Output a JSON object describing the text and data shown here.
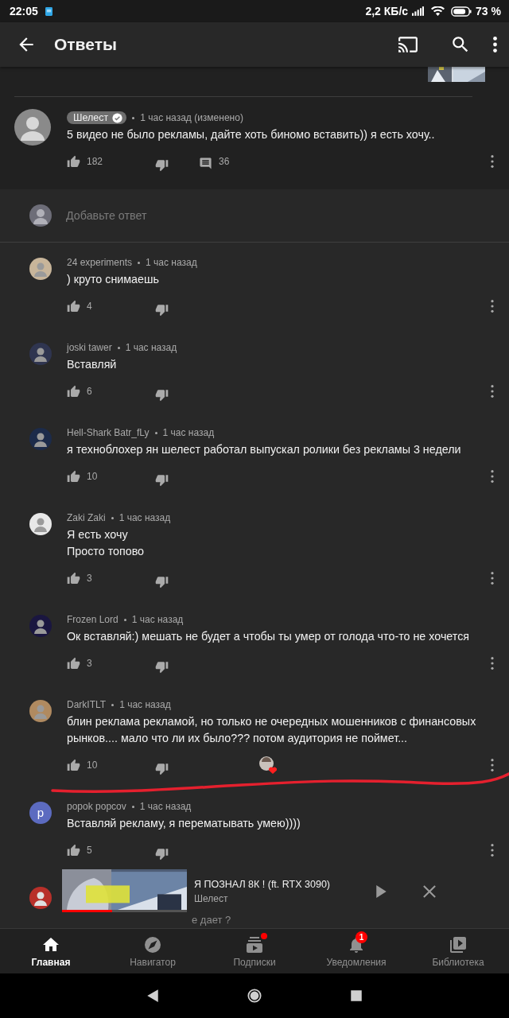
{
  "status_bar": {
    "time": "22:05",
    "speed": "2,2 КБ/с",
    "battery": "73 %"
  },
  "app_bar": {
    "title": "Ответы"
  },
  "parent_comment": {
    "author": "Шелест",
    "owner": true,
    "verified": true,
    "time": "1 час назад (изменено)",
    "text": "5 видео не было рекламы, дайте хоть биномо вставить)) я есть хочу..",
    "likes": "182",
    "replies": "36",
    "color": "#8a8a8a"
  },
  "reply_field": {
    "placeholder": "Добавьте ответ"
  },
  "replies": [
    {
      "author": "24 experiments",
      "time": "1 час назад",
      "text": ") круто снимаешь",
      "likes": "4",
      "hearted": false,
      "color": "#c8b59a"
    },
    {
      "author": "joski tawer",
      "time": "1 час назад",
      "text": "Вставляй",
      "likes": "6",
      "hearted": false,
      "color": "#2f3550"
    },
    {
      "author": "Hell-Shark Batr_fLy",
      "time": "1 час назад",
      "text": "я техноблохер ян шелест работал выпускал ролики без рекламы 3 недели",
      "likes": "10",
      "hearted": false,
      "color": "#1c2b4a"
    },
    {
      "author": "Zaki Zaki",
      "time": "1 час назад",
      "text": "Я есть хочу\nПросто топово",
      "likes": "3",
      "hearted": false,
      "color": "#e8e8e8"
    },
    {
      "author": "Frozen Lord",
      "time": "1 час назад",
      "text": "Ок вставляй:) мешать не будет а чтобы ты умер от голода что-то не хочется",
      "likes": "3",
      "hearted": false,
      "color": "#1a1640"
    },
    {
      "author": "DarkITLT",
      "time": "1 час назад",
      "text": "блин реклама рекламой, но только не очередных мошенников с финансовых рынков.... мало что ли их было??? потом аудитория не поймет...",
      "likes": "10",
      "hearted": true,
      "color": "#b08a60"
    },
    {
      "author": "popok popcov",
      "time": "1 час назад",
      "text": "Вставляй рекламу, я перематывать умею))))",
      "likes": "5",
      "hearted": false,
      "color": "#5c6bc0",
      "letter": "p"
    }
  ],
  "partial_reply": {
    "text": "е дает ?",
    "color": "#b8302a"
  },
  "mini_player": {
    "title": "Я ПОЗНАЛ 8К ! (ft. RTX 3090)",
    "channel": "Шелест",
    "level": 0.4
  },
  "nav": {
    "tabs": [
      {
        "label": "Главная",
        "selected": true,
        "dot": false
      },
      {
        "label": "Навигатор",
        "selected": false,
        "dot": false
      },
      {
        "label": "Подписки",
        "selected": false,
        "dot": true
      },
      {
        "label": "Уведомления",
        "selected": false,
        "dot": false,
        "badge": "1"
      },
      {
        "label": "Библиотека",
        "selected": false,
        "dot": false
      }
    ]
  }
}
